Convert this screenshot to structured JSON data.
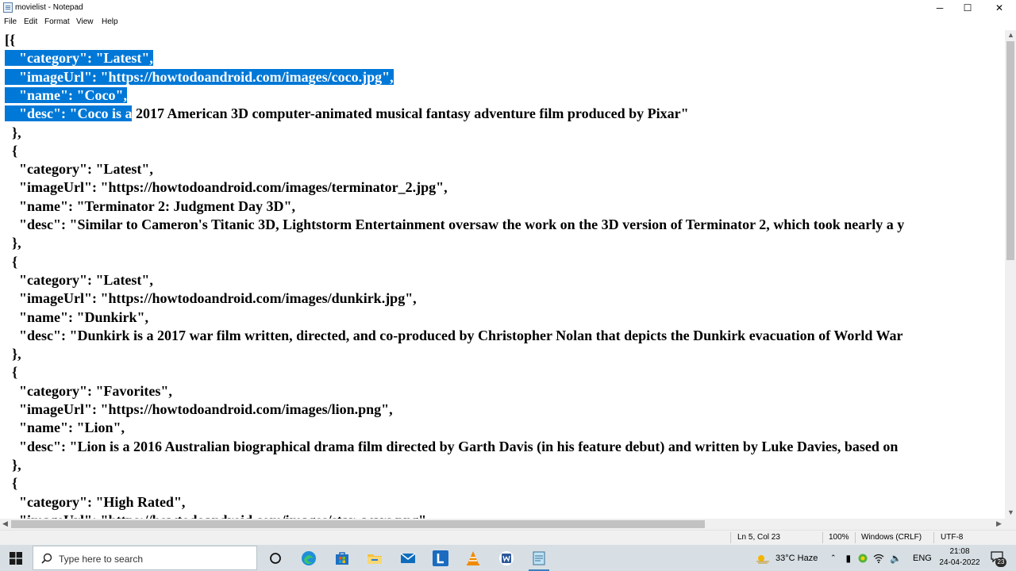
{
  "window": {
    "title": "movielist - Notepad",
    "minimize_glyph": "─",
    "maximize_glyph": "☐",
    "close_glyph": "✕"
  },
  "menu": [
    "File",
    "Edit",
    "Format",
    "View",
    "Help"
  ],
  "editor": {
    "lines": [
      "[{",
      "    \"category\": \"Latest\",",
      "    \"imageUrl\": \"https://howtodoandroid.com/images/coco.jpg\",",
      "    \"name\": \"Coco\",",
      "    \"desc\": \"Coco is a 2017 American 3D computer-animated musical fantasy adventure film produced by Pixar\"",
      "  },",
      "  {",
      "    \"category\": \"Latest\",",
      "    \"imageUrl\": \"https://howtodoandroid.com/images/terminator_2.jpg\",",
      "    \"name\": \"Terminator 2: Judgment Day 3D\",",
      "    \"desc\": \"Similar to Cameron's Titanic 3D, Lightstorm Entertainment oversaw the work on the 3D version of Terminator 2, which took nearly a y",
      "  },",
      "  {",
      "    \"category\": \"Latest\",",
      "    \"imageUrl\": \"https://howtodoandroid.com/images/dunkirk.jpg\",",
      "    \"name\": \"Dunkirk\",",
      "    \"desc\": \"Dunkirk is a 2017 war film written, directed, and co-produced by Christopher Nolan that depicts the Dunkirk evacuation of World War",
      "  },",
      "  {",
      "    \"category\": \"Favorites\",",
      "    \"imageUrl\": \"https://howtodoandroid.com/images/lion.png\",",
      "    \"name\": \"Lion\",",
      "    \"desc\": \"Lion is a 2016 Australian biographical drama film directed by Garth Davis (in his feature debut) and written by Luke Davies, based on",
      "  },",
      "  {",
      "    \"category\": \"High Rated\",",
      "    \"imageUrl\": \"https://howtodoandroid.com/images/star_wars.png\","
    ],
    "selection_end": {
      "line": 5,
      "col": 23
    }
  },
  "status": {
    "position": "Ln 5, Col 23",
    "zoom": "100%",
    "line_ending": "Windows (CRLF)",
    "encoding": "UTF-8"
  },
  "taskbar": {
    "search_placeholder": "Type here to search",
    "apps": [
      "task-view-icon",
      "edge-icon",
      "store-icon",
      "file-explorer-icon",
      "mail-icon",
      "l-app-icon",
      "vlc-icon",
      "word-icon",
      "notepad-icon"
    ],
    "weather": "33°C  Haze",
    "language": "ENG",
    "time": "21:08",
    "date": "24-04-2022",
    "notification_count": "23"
  },
  "colors": {
    "selection": "#0078d7",
    "taskbar": "#d7dfe4",
    "statusbar": "#f0f0f0"
  }
}
